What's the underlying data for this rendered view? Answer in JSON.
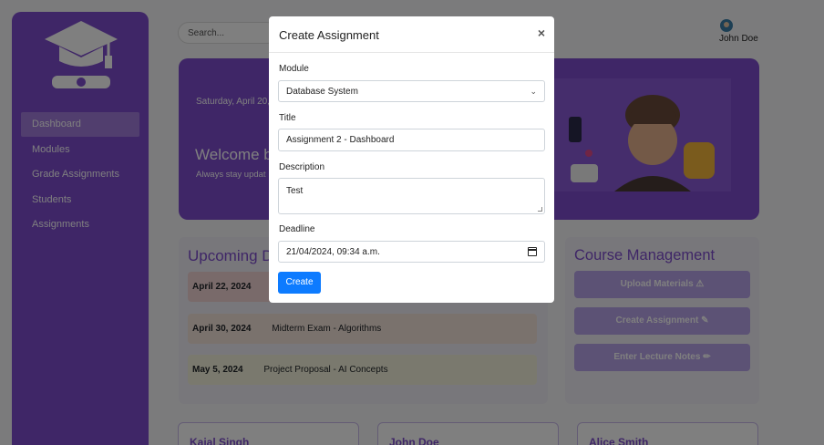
{
  "sidebar": {
    "items": [
      {
        "label": "Dashboard"
      },
      {
        "label": "Modules"
      },
      {
        "label": "Grade Assignments"
      },
      {
        "label": "Students"
      },
      {
        "label": "Assignments"
      }
    ],
    "logo_icon": "graduation-cap-icon"
  },
  "header": {
    "search_placeholder": "Search...",
    "user_name": "John Doe"
  },
  "hero": {
    "date": "Saturday, April 20,",
    "welcome": "Welcome b",
    "subtitle": "Always stay updat"
  },
  "upcoming": {
    "title": "Upcoming D",
    "rows": [
      {
        "date": "April 22, 2024",
        "title": ""
      },
      {
        "date": "April 30, 2024",
        "title": "Midterm Exam - Algorithms"
      },
      {
        "date": "May 5, 2024",
        "title": "Project Proposal - AI Concepts"
      }
    ]
  },
  "course_management": {
    "title": "Course Management",
    "buttons": [
      {
        "label": "Upload Materials",
        "icon": "upload-icon"
      },
      {
        "label": "Create Assignment",
        "icon": "edit-icon"
      },
      {
        "label": "Enter Lecture Notes",
        "icon": "pencil-icon"
      }
    ]
  },
  "students": [
    {
      "name": "Kajal Singh"
    },
    {
      "name": "John Doe"
    },
    {
      "name": "Alice Smith"
    }
  ],
  "modal": {
    "title": "Create Assignment",
    "close": "×",
    "module_label": "Module",
    "module_value": "Database System",
    "title_label": "Title",
    "title_value": "Assignment 2 - Dashboard",
    "description_label": "Description",
    "description_value": "Test",
    "deadline_label": "Deadline",
    "deadline_value": "21/04/2024, 09:34 a.m.",
    "create_label": "Create"
  },
  "colors": {
    "brand_purple": "#7e4ccf",
    "primary_blue": "#0d7bff"
  }
}
